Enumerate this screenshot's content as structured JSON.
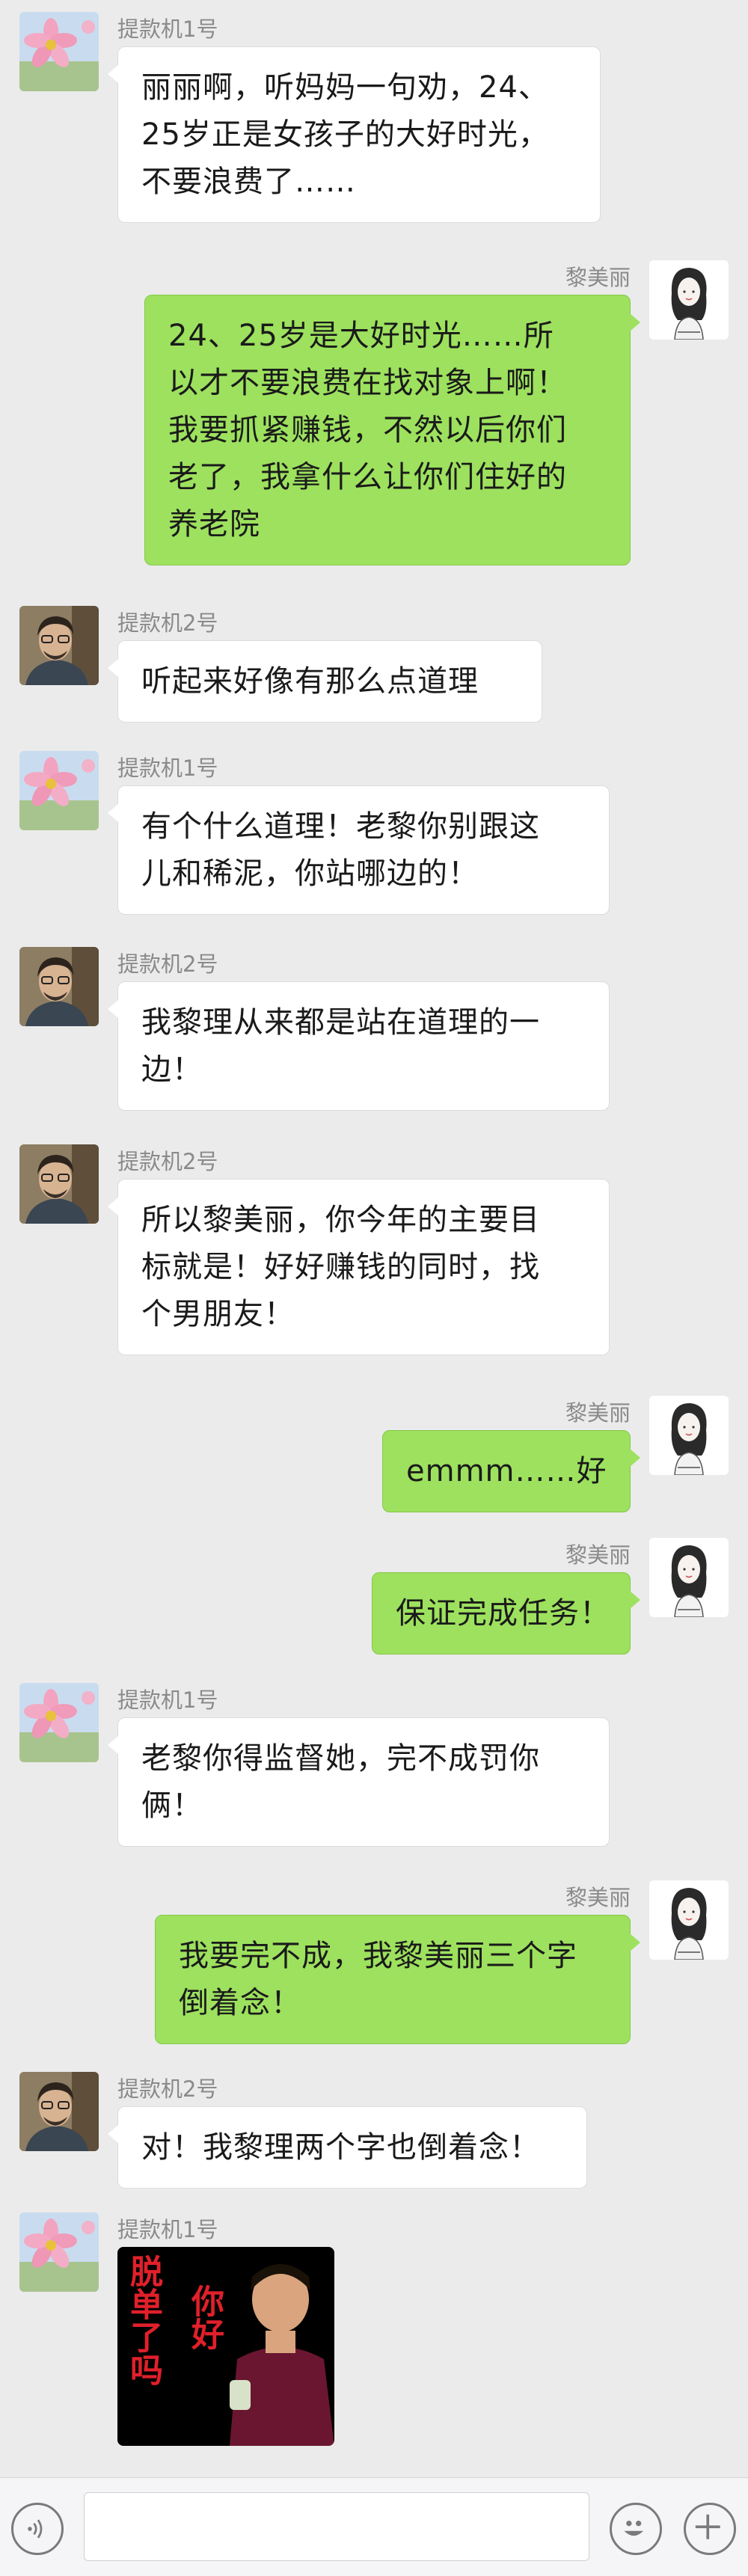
{
  "chat": {
    "messages": [
      {
        "sender": "提款机1号",
        "side": "left",
        "avatar": "flower-avatar",
        "lines": [
          "丽丽啊，听妈妈一句劝，24、",
          "25岁正是女孩子的大好时光，",
          "不要浪费了……"
        ]
      },
      {
        "sender": "黎美丽",
        "side": "right",
        "avatar": "girl-avatar",
        "lines": [
          "24、25岁是大好时光……所",
          "以才不要浪费在找对象上啊！",
          "我要抓紧赚钱，不然以后你们",
          "老了，我拿什么让你们住好的",
          "养老院"
        ]
      },
      {
        "sender": "提款机2号",
        "side": "left",
        "avatar": "man-avatar",
        "lines": [
          "听起来好像有那么点道理"
        ]
      },
      {
        "sender": "提款机1号",
        "side": "left",
        "avatar": "flower-avatar",
        "lines": [
          "有个什么道理！老黎你别跟这",
          "儿和稀泥，你站哪边的！"
        ]
      },
      {
        "sender": "提款机2号",
        "side": "left",
        "avatar": "man-avatar",
        "lines": [
          "我黎理从来都是站在道理的一",
          "边！"
        ]
      },
      {
        "sender": "提款机2号",
        "side": "left",
        "avatar": "man-avatar",
        "lines": [
          "所以黎美丽，你今年的主要目",
          "标就是！好好赚钱的同时，找",
          "个男朋友！"
        ]
      },
      {
        "sender": "黎美丽",
        "side": "right",
        "avatar": "girl-avatar",
        "lines": [
          "emmm……好"
        ]
      },
      {
        "sender": "黎美丽",
        "side": "right",
        "avatar": "girl-avatar",
        "lines": [
          "保证完成任务！"
        ]
      },
      {
        "sender": "提款机1号",
        "side": "left",
        "avatar": "flower-avatar",
        "lines": [
          "老黎你得监督她，完不成罚你",
          "俩！"
        ]
      },
      {
        "sender": "黎美丽",
        "side": "right",
        "avatar": "girl-avatar",
        "lines": [
          "我要完不成，我黎美丽三个字",
          "倒着念！"
        ]
      },
      {
        "sender": "提款机2号",
        "side": "left",
        "avatar": "man-avatar",
        "lines": [
          "对！我黎理两个字也倒着念！"
        ]
      }
    ],
    "sticker": {
      "sender": "提款机1号",
      "caption_left": "脱单了吗",
      "caption_right": "你好"
    }
  },
  "toolbar": {
    "voice_icon": "voice-icon",
    "emoji_icon": "emoji-icon",
    "plus_icon": "plus-icon"
  },
  "colors": {
    "background": "#ebebeb",
    "self_bubble": "#9de15e",
    "other_bubble": "#ffffff"
  }
}
